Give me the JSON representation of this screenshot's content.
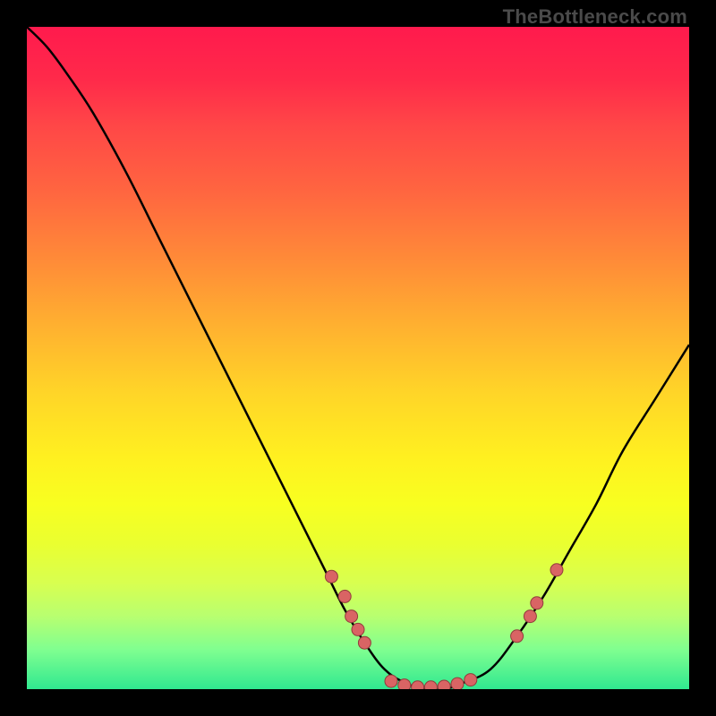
{
  "watermark": "TheBottleneck.com",
  "colors": {
    "gradient_top": "#ff1a4d",
    "gradient_bottom": "#30e890",
    "curve": "#000000",
    "marker_fill": "#d96464",
    "marker_stroke": "#923c3c"
  },
  "chart_data": {
    "type": "line",
    "title": "",
    "xlabel": "",
    "ylabel": "",
    "xlim": [
      0,
      100
    ],
    "ylim": [
      0,
      100
    ],
    "curve": [
      {
        "x": 0,
        "y": 100
      },
      {
        "x": 3,
        "y": 97
      },
      {
        "x": 6,
        "y": 93
      },
      {
        "x": 10,
        "y": 87
      },
      {
        "x": 15,
        "y": 78
      },
      {
        "x": 20,
        "y": 68
      },
      {
        "x": 25,
        "y": 58
      },
      {
        "x": 30,
        "y": 48
      },
      {
        "x": 35,
        "y": 38
      },
      {
        "x": 40,
        "y": 28
      },
      {
        "x": 45,
        "y": 18
      },
      {
        "x": 48,
        "y": 12
      },
      {
        "x": 51,
        "y": 7
      },
      {
        "x": 54,
        "y": 3
      },
      {
        "x": 57,
        "y": 1
      },
      {
        "x": 60,
        "y": 0
      },
      {
        "x": 63,
        "y": 0
      },
      {
        "x": 66,
        "y": 1
      },
      {
        "x": 70,
        "y": 3
      },
      {
        "x": 74,
        "y": 8
      },
      {
        "x": 78,
        "y": 14
      },
      {
        "x": 82,
        "y": 21
      },
      {
        "x": 86,
        "y": 28
      },
      {
        "x": 90,
        "y": 36
      },
      {
        "x": 95,
        "y": 44
      },
      {
        "x": 100,
        "y": 52
      }
    ],
    "markers": [
      {
        "x": 46,
        "y": 17
      },
      {
        "x": 48,
        "y": 14
      },
      {
        "x": 49,
        "y": 11
      },
      {
        "x": 50,
        "y": 9
      },
      {
        "x": 51,
        "y": 7
      },
      {
        "x": 55,
        "y": 1.2
      },
      {
        "x": 57,
        "y": 0.6
      },
      {
        "x": 59,
        "y": 0.3
      },
      {
        "x": 61,
        "y": 0.3
      },
      {
        "x": 63,
        "y": 0.4
      },
      {
        "x": 65,
        "y": 0.8
      },
      {
        "x": 67,
        "y": 1.4
      },
      {
        "x": 74,
        "y": 8
      },
      {
        "x": 76,
        "y": 11
      },
      {
        "x": 77,
        "y": 13
      },
      {
        "x": 80,
        "y": 18
      }
    ]
  }
}
